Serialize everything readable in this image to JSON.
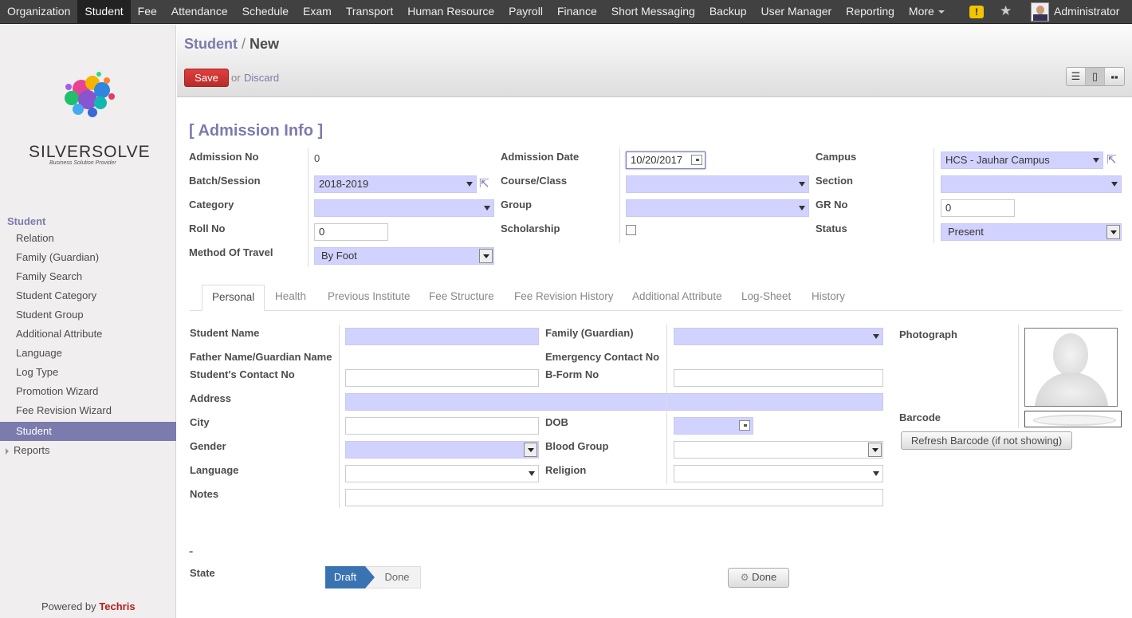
{
  "topnav": {
    "items": [
      "Organization",
      "Student",
      "Fee",
      "Attendance",
      "Schedule",
      "Exam",
      "Transport",
      "Human Resource",
      "Payroll",
      "Finance",
      "Short Messaging",
      "Backup",
      "User Manager",
      "Reporting",
      "More"
    ],
    "active": "Student",
    "warning": "!",
    "user": "Administrator"
  },
  "sidebar": {
    "logo_name": "SILVERSOLVE",
    "logo_tagline": "Business Solution Provider",
    "section": "Student",
    "items": [
      "Relation",
      "Family (Guardian)",
      "Family Search",
      "Student Category",
      "Student Group",
      "Additional Attribute",
      "Language",
      "Log Type",
      "Promotion Wizard",
      "Fee Revision Wizard",
      "Student"
    ],
    "active": "Student",
    "reports": "Reports",
    "powered_prefix": "Powered by",
    "powered_brand": "Techris"
  },
  "breadcrumb": {
    "parent": "Student",
    "separator": "/",
    "current": "New"
  },
  "actions": {
    "save": "Save",
    "or": "or",
    "discard": "Discard"
  },
  "form": {
    "title": "[ Admission Info ]",
    "admission_no": {
      "label": "Admission No",
      "value": "0"
    },
    "admission_date": {
      "label": "Admission Date",
      "value": "10/20/2017"
    },
    "campus": {
      "label": "Campus",
      "value": "HCS - Jauhar Campus"
    },
    "batch": {
      "label": "Batch/Session",
      "value": "2018-2019"
    },
    "course": {
      "label": "Course/Class",
      "value": ""
    },
    "section": {
      "label": "Section",
      "value": ""
    },
    "category": {
      "label": "Category",
      "value": ""
    },
    "group": {
      "label": "Group",
      "value": ""
    },
    "gr_no": {
      "label": "GR No",
      "value": "0"
    },
    "roll_no": {
      "label": "Roll No",
      "value": "0"
    },
    "scholarship": {
      "label": "Scholarship",
      "checked": false
    },
    "status": {
      "label": "Status",
      "value": "Present"
    },
    "travel": {
      "label": "Method Of Travel",
      "value": "By Foot"
    }
  },
  "tabs": [
    "Personal",
    "Health",
    "Previous Institute",
    "Fee Structure",
    "Fee Revision History",
    "Additional Attribute",
    "Log-Sheet",
    "History"
  ],
  "active_tab": "Personal",
  "personal": {
    "student_name": "Student Name",
    "family": "Family (Guardian)",
    "father_name": "Father Name/Guardian Name",
    "emergency": "Emergency Contact No",
    "contact": "Student's Contact No",
    "bform": "B-Form No",
    "address": "Address",
    "city": "City",
    "dob": "DOB",
    "gender": "Gender",
    "blood_group": "Blood Group",
    "language": "Language",
    "religion": "Religion",
    "notes": "Notes",
    "photograph": "Photograph",
    "barcode": "Barcode",
    "refresh_barcode": "Refresh Barcode (if not showing)"
  },
  "footer": {
    "dash": "-",
    "state_label": "State",
    "states": [
      "Draft",
      "Done"
    ],
    "active_state": "Draft",
    "done_button": "Done"
  }
}
